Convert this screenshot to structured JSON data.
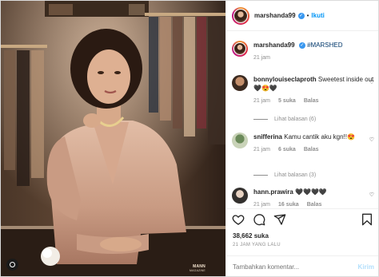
{
  "post": {
    "author": {
      "username": "marshanda99",
      "verified": true,
      "follow_label": "Ikuti"
    },
    "caption": {
      "username": "marshanda99",
      "hashtag": "#MARSHED",
      "time": "21 jam"
    },
    "comments": [
      {
        "username": "bonnylouiseclaproth",
        "text": "Sweetest inside out🖤😍🖤",
        "time": "21 jam",
        "likes": "5 suka",
        "reply_label": "Balas",
        "replies_label": "Lihat balasan (6)"
      },
      {
        "username": "snifferina",
        "text": "Kamu cantik aku kgn!!😍",
        "time": "21 jam",
        "likes": "6 suka",
        "reply_label": "Balas",
        "replies_label": "Lihat balasan (3)"
      },
      {
        "username": "hann.prawira",
        "text": "🖤🖤🖤🖤",
        "time": "21 jam",
        "likes": "16 suka",
        "reply_label": "Balas"
      }
    ],
    "likes_count": "38,662 suka",
    "posted": "21 JAM YANG LALU",
    "add_comment": {
      "placeholder": "Tambahkan komentar...",
      "post_label": "Kirim"
    },
    "photo_watermark": {
      "title": "MANN",
      "subtitle": "MAGAZINE"
    }
  },
  "icons": {
    "verified": "verified-badge-icon",
    "like": "heart-icon",
    "comment": "comment-icon",
    "share": "share-icon",
    "save": "bookmark-icon"
  },
  "colors": {
    "link_blue": "#0095f6",
    "verified_blue": "#3897f0",
    "muted": "#8e8e8e",
    "text": "#262626"
  }
}
